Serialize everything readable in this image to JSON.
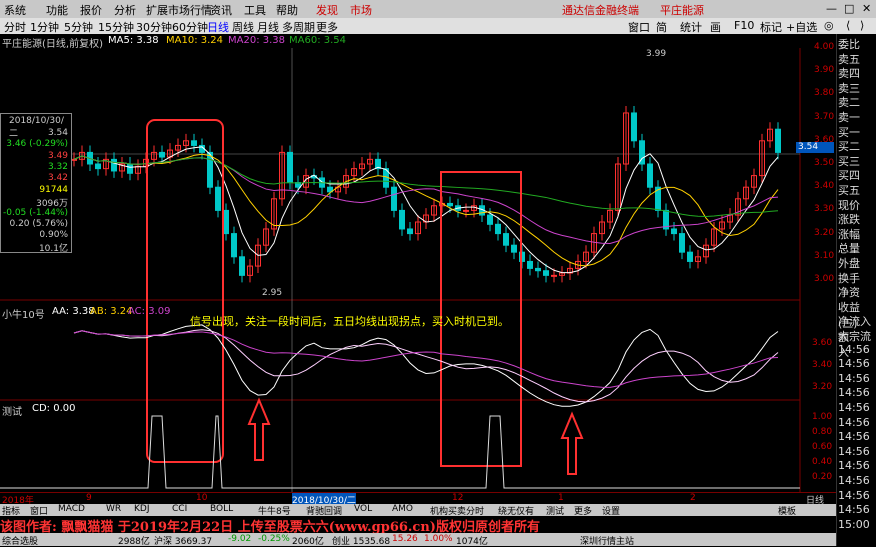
{
  "menubar": {
    "items": [
      "系统",
      "功能",
      "报价",
      "分析",
      "扩展市场行情",
      "资讯",
      "工具",
      "帮助"
    ],
    "right_tabs": [
      "发现",
      "市场"
    ],
    "center_text": "通达信金融终端",
    "stock_title": "平庄能源",
    "controls": [
      "—",
      "□",
      "✕"
    ]
  },
  "periodbar": {
    "periods": [
      "分时",
      "1分钟",
      "5分钟",
      "15分钟",
      "30分钟",
      "60分钟",
      "日线",
      "周线",
      "月线",
      "多周期",
      "更多"
    ],
    "active": "日线",
    "tools": [
      "窗口",
      "简",
      "统计",
      "画",
      "F10",
      "标记",
      "+自选",
      "◎",
      "⟨",
      "⟩"
    ]
  },
  "infobar": {
    "name": "平庄能源(日线,前复权)",
    "ma5": "MA5: 3.38",
    "ma10": "MA10: 3.24",
    "ma20": "MA20: 3.38",
    "ma60": "MA60: 3.54"
  },
  "colors": {
    "up": "#ff3030",
    "down": "#00c8c8",
    "ma5": "#ffffff",
    "ma10": "#ffd000",
    "ma20": "#cc44cc",
    "ma60": "#22aa22",
    "frame": "#ff3030"
  },
  "price_axis": [
    "4.00",
    "3.90",
    "3.80",
    "3.70",
    "3.60",
    "3.54",
    "3.50",
    "3.40",
    "3.30",
    "3.20",
    "3.10",
    "3.00"
  ],
  "price_marks": {
    "high": "3.99",
    "low": "2.95"
  },
  "cursor_box": {
    "date": "2018/10/30/二",
    "rows": [
      "3.54",
      "3.46 (-0.29%)",
      "3.49",
      "3.32",
      "3.42",
      "91744",
      "3096万",
      "-0.05 (-1.44%)",
      "0.20 (5.76%)",
      "0.90%",
      "10.1亿"
    ]
  },
  "sub1": {
    "title": "小牛10号",
    "aa": "AA: 3.38",
    "ab": "AB: 3.24",
    "ac": "AC: 3.09",
    "axis": [
      "3.60",
      "3.40",
      "3.20"
    ]
  },
  "annotation": "信号出现，关注一段时间后，五日均线出现拐点，买入时机已到。",
  "sub2": {
    "title": "测试",
    "cd": "CD: 0.00",
    "axis": [
      "1.00",
      "0.80",
      "0.60",
      "0.40",
      "0.20"
    ]
  },
  "date_axis": {
    "labels": [
      "2018年",
      "9",
      "10",
      "2018/10/30/二",
      "12",
      "1",
      "2"
    ],
    "period": "日线"
  },
  "bottom_tabs": [
    "指标",
    "窗口",
    "MACD",
    "WR",
    "KDJ",
    "CCI",
    "BOLL",
    "牛牛8号",
    "背驰回调",
    "VOL",
    "AMO",
    "机构买卖分时",
    "绕无仅有",
    "测试",
    "更多",
    "设置"
  ],
  "right_tab": "模板",
  "side_panel": [
    "委比",
    "卖五",
    "卖四",
    "卖三",
    "卖二",
    "卖一",
    "买一",
    "买二",
    "买三",
    "买四",
    "买五",
    "现价",
    "涨跌",
    "涨幅",
    "总量",
    "外盘",
    "换手",
    "净资",
    "收益(三)",
    "净流入额",
    "大宗流入",
    "14:56",
    "14:56",
    "14:56",
    "14:56",
    "14:56",
    "14:56",
    "14:56",
    "14:56",
    "14:56",
    "14:56",
    "14:56",
    "14:56",
    "15:00"
  ],
  "watermark": "该图作者: 飘飘猫猫 于2019年2月22日 上传至股票六六(www.gp66.cn)版权归原创者所有",
  "statusbar": {
    "label": "综合选股",
    "vol1": "2988亿",
    "shenzhen": "沪深 3669.37",
    "chg1": "-9.02",
    "pct1": "-0.25%",
    "vol2": "2060亿",
    "chuangye": "创业 1535.68",
    "chg2": "15.26",
    "pct2": "1.00%",
    "vol3": "1074亿",
    "market": "深圳行情主站"
  }
}
